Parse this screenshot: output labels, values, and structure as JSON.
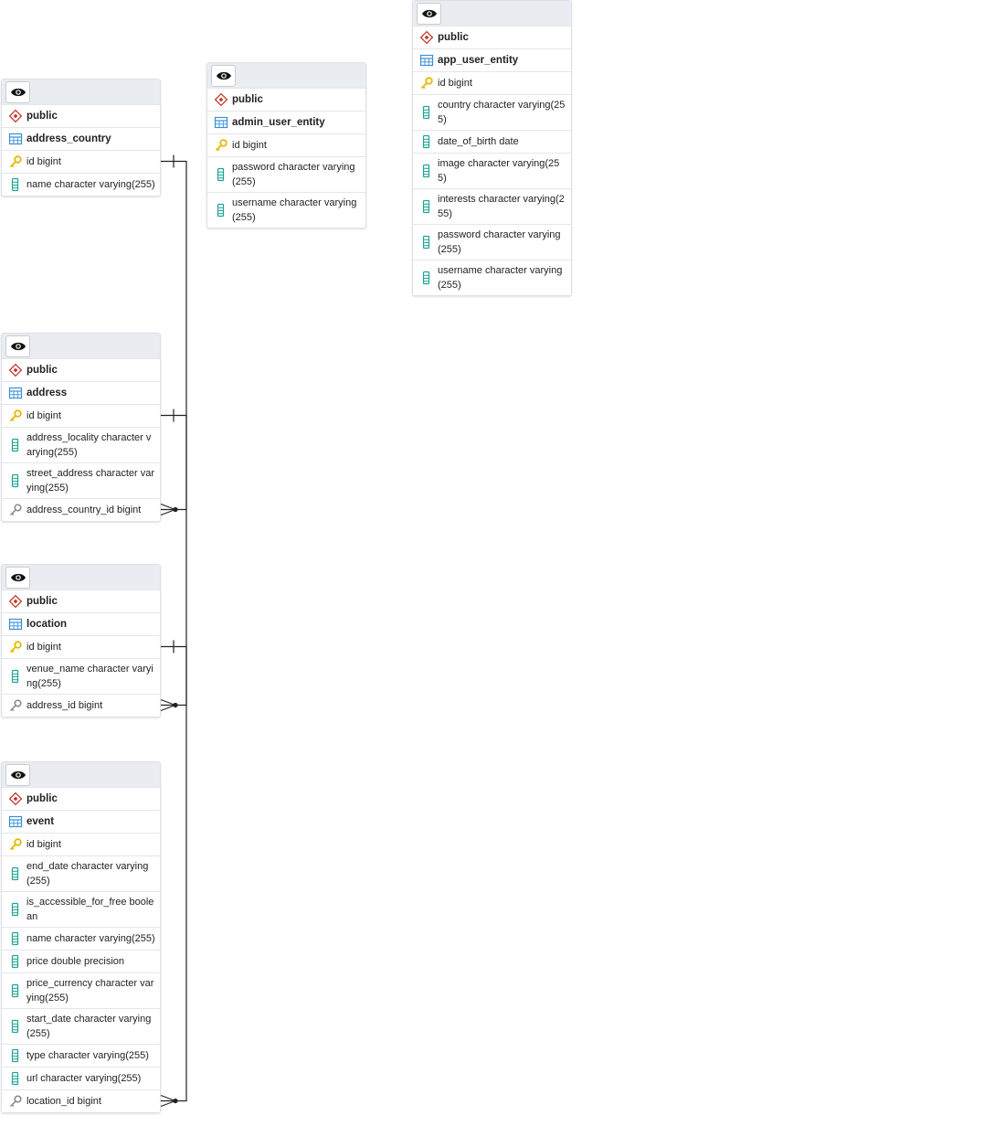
{
  "entities": [
    {
      "id": "address_country",
      "schema": "public",
      "table": "address_country",
      "columns": [
        {
          "text": "id bigint",
          "kind": "pk"
        },
        {
          "text": "name character varying(255)",
          "kind": "col"
        }
      ]
    },
    {
      "id": "admin_user_entity",
      "schema": "public",
      "table": "admin_user_entity",
      "columns": [
        {
          "text": "id bigint",
          "kind": "pk"
        },
        {
          "text": "password character varying(255)",
          "kind": "col"
        },
        {
          "text": "username character varying(255)",
          "kind": "col"
        }
      ]
    },
    {
      "id": "app_user_entity",
      "schema": "public",
      "table": "app_user_entity",
      "columns": [
        {
          "text": "id bigint",
          "kind": "pk"
        },
        {
          "text": "country character varying(255)",
          "kind": "col"
        },
        {
          "text": "date_of_birth date",
          "kind": "col"
        },
        {
          "text": "image character varying(255)",
          "kind": "col"
        },
        {
          "text": "interests character varying(255)",
          "kind": "col"
        },
        {
          "text": "password character varying(255)",
          "kind": "col"
        },
        {
          "text": "username character varying(255)",
          "kind": "col"
        }
      ]
    },
    {
      "id": "address",
      "schema": "public",
      "table": "address",
      "columns": [
        {
          "text": "id bigint",
          "kind": "pk"
        },
        {
          "text": "address_locality character varying(255)",
          "kind": "col"
        },
        {
          "text": "street_address character varying(255)",
          "kind": "col"
        },
        {
          "text": "address_country_id bigint",
          "kind": "fk"
        }
      ]
    },
    {
      "id": "location",
      "schema": "public",
      "table": "location",
      "columns": [
        {
          "text": "id bigint",
          "kind": "pk"
        },
        {
          "text": "venue_name character varying(255)",
          "kind": "col"
        },
        {
          "text": "address_id bigint",
          "kind": "fk"
        }
      ]
    },
    {
      "id": "event",
      "schema": "public",
      "table": "event",
      "columns": [
        {
          "text": "id bigint",
          "kind": "pk"
        },
        {
          "text": "end_date character varying(255)",
          "kind": "col"
        },
        {
          "text": "is_accessible_for_free boolean",
          "kind": "col"
        },
        {
          "text": "name character varying(255)",
          "kind": "col"
        },
        {
          "text": "price double precision",
          "kind": "col"
        },
        {
          "text": "price_currency character varying(255)",
          "kind": "col"
        },
        {
          "text": "start_date character varying(255)",
          "kind": "col"
        },
        {
          "text": "type character varying(255)",
          "kind": "col"
        },
        {
          "text": "url character varying(255)",
          "kind": "col"
        },
        {
          "text": "location_id bigint",
          "kind": "fk"
        }
      ]
    }
  ],
  "relations": [
    {
      "from": "address.address_country_id",
      "to": "address_country.id"
    },
    {
      "from": "location.address_id",
      "to": "address.id"
    },
    {
      "from": "event.location_id",
      "to": "location.id"
    }
  ],
  "colors": {
    "header": "#e9ecf0",
    "schema_icon": "#c0392b",
    "table_icon": "#3a8fd6",
    "pk_icon": "#e6b800",
    "col_icon": "#1fa398",
    "fk_icon": "#888888",
    "line": "#222222"
  }
}
